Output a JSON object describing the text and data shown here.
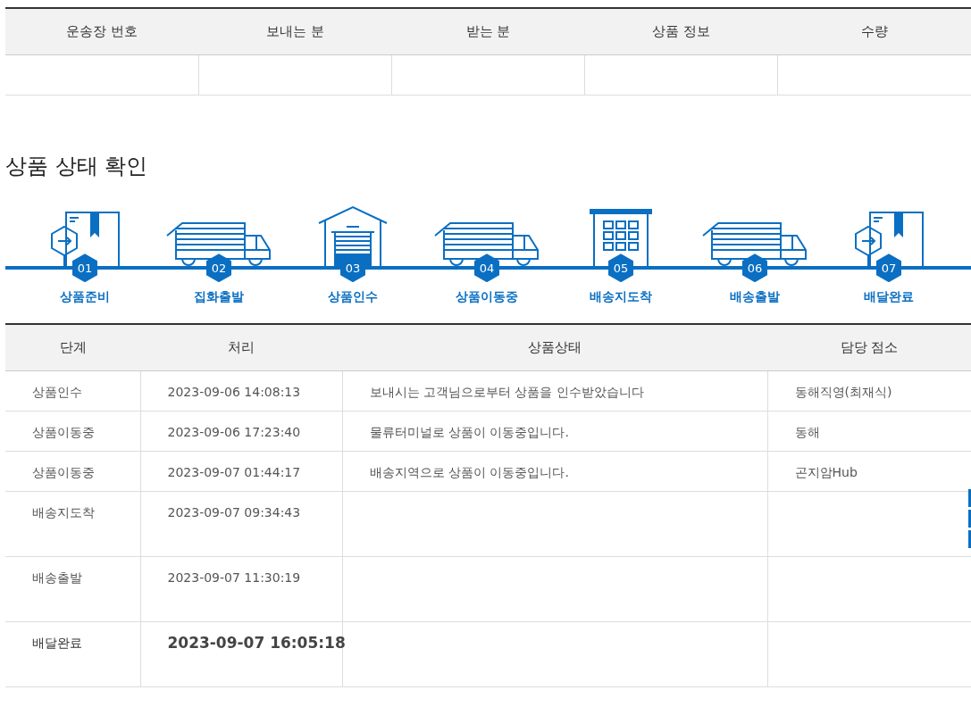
{
  "summary_table": {
    "columns": [
      "운송장 번호",
      "보내는 분",
      "받는 분",
      "상품 정보",
      "수량"
    ]
  },
  "section_title": "상품 상태 확인",
  "steps": [
    {
      "number": "01",
      "label": "상품준비",
      "kind": "box"
    },
    {
      "number": "02",
      "label": "집화출발",
      "kind": "truck"
    },
    {
      "number": "03",
      "label": "상품인수",
      "kind": "warehouse"
    },
    {
      "number": "04",
      "label": "상품이동중",
      "kind": "truck"
    },
    {
      "number": "05",
      "label": "배송지도착",
      "kind": "building"
    },
    {
      "number": "06",
      "label": "배송출발",
      "kind": "truck"
    },
    {
      "number": "07",
      "label": "배달완료",
      "kind": "box"
    }
  ],
  "history_table": {
    "columns": [
      "단계",
      "처리",
      "상품상태",
      "담당 점소"
    ],
    "rows": [
      {
        "step": "상품인수",
        "time": "2023-09-06 14:08:13",
        "status": "보내시는 고객님으로부터 상품을 인수받았습니다",
        "office": "동해직영(최재식)",
        "highlighted": false
      },
      {
        "step": "상품이동중",
        "time": "2023-09-06 17:23:40",
        "status": "물류터미널로 상품이 이동중입니다.",
        "office": "동해",
        "highlighted": false
      },
      {
        "step": "상품이동중",
        "time": "2023-09-07 01:44:17",
        "status": "배송지역으로 상품이 이동중입니다.",
        "office": "곤지암Hub",
        "highlighted": false
      },
      {
        "step": "배송지도착",
        "time": "2023-09-07 09:34:43",
        "highlighted": false
      },
      {
        "step": "배송출발",
        "time": "2023-09-07 11:30:19",
        "highlighted": false
      },
      {
        "step": "배달완료",
        "time": "2023-09-07 16:05:18",
        "highlighted": true
      }
    ]
  }
}
